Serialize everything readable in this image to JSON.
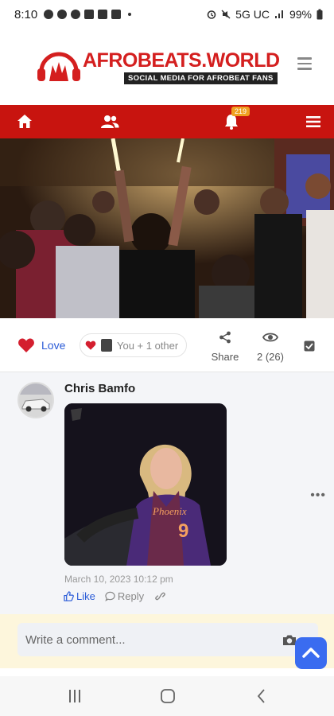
{
  "status_bar": {
    "time": "8:10",
    "network": "5G UC",
    "battery": "99%"
  },
  "header": {
    "brand": "AFROBEATS.WORLD",
    "tagline": "SOCIAL MEDIA FOR AFROBEAT FANS"
  },
  "nav": {
    "notification_count": "219"
  },
  "post": {
    "love_label": "Love",
    "reactors_text": "You + 1 other",
    "share_label": "Share",
    "views_label": "2 (26)"
  },
  "comment": {
    "author": "Chris Bamfo",
    "timestamp": "March 10, 2023 10:12 pm",
    "like_label": "Like",
    "reply_label": "Reply",
    "jersey_team": "Phoenix",
    "jersey_number": "9"
  },
  "composer": {
    "placeholder": "Write a comment..."
  },
  "colors": {
    "brand_red": "#c8140f",
    "link_blue": "#2a5bd7",
    "scroll_button": "#3a6cf0"
  }
}
